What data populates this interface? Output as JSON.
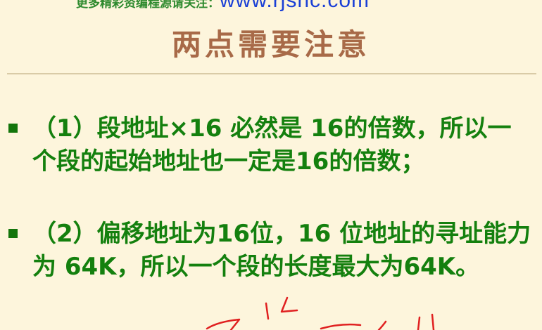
{
  "header": {
    "watermark_prefix": "更多精彩资编程源请关注：",
    "watermark_url": "www.rjsnc.com"
  },
  "slide": {
    "title": "两点需要注意",
    "points": [
      {
        "text": "（1）段地址×16 必然是 16的倍数，所以一个段的起始地址也一定是16的倍数；"
      },
      {
        "text": "（2）偏移地址为16位，16 位地址的寻址能力为 64K，所以一个段的长度最大为64K。"
      }
    ]
  },
  "colors": {
    "background": "#fdf5dc",
    "title": "#a86a48",
    "body_text": "#14800e",
    "watermark_url": "#1a3fd6",
    "annotation": "#e02020"
  }
}
